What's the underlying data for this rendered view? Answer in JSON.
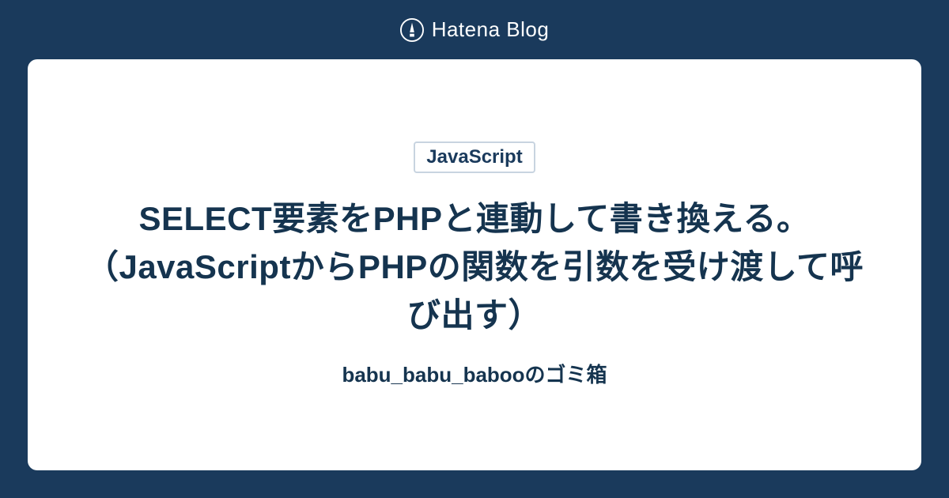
{
  "header": {
    "logo_text": "Hatena Blog"
  },
  "card": {
    "tag": "JavaScript",
    "title": "SELECT要素をPHPと連動して書き換える。（JavaScriptからPHPの関数を引数を受け渡して呼び出す）",
    "subtitle": "babu_babu_babooのゴミ箱"
  }
}
